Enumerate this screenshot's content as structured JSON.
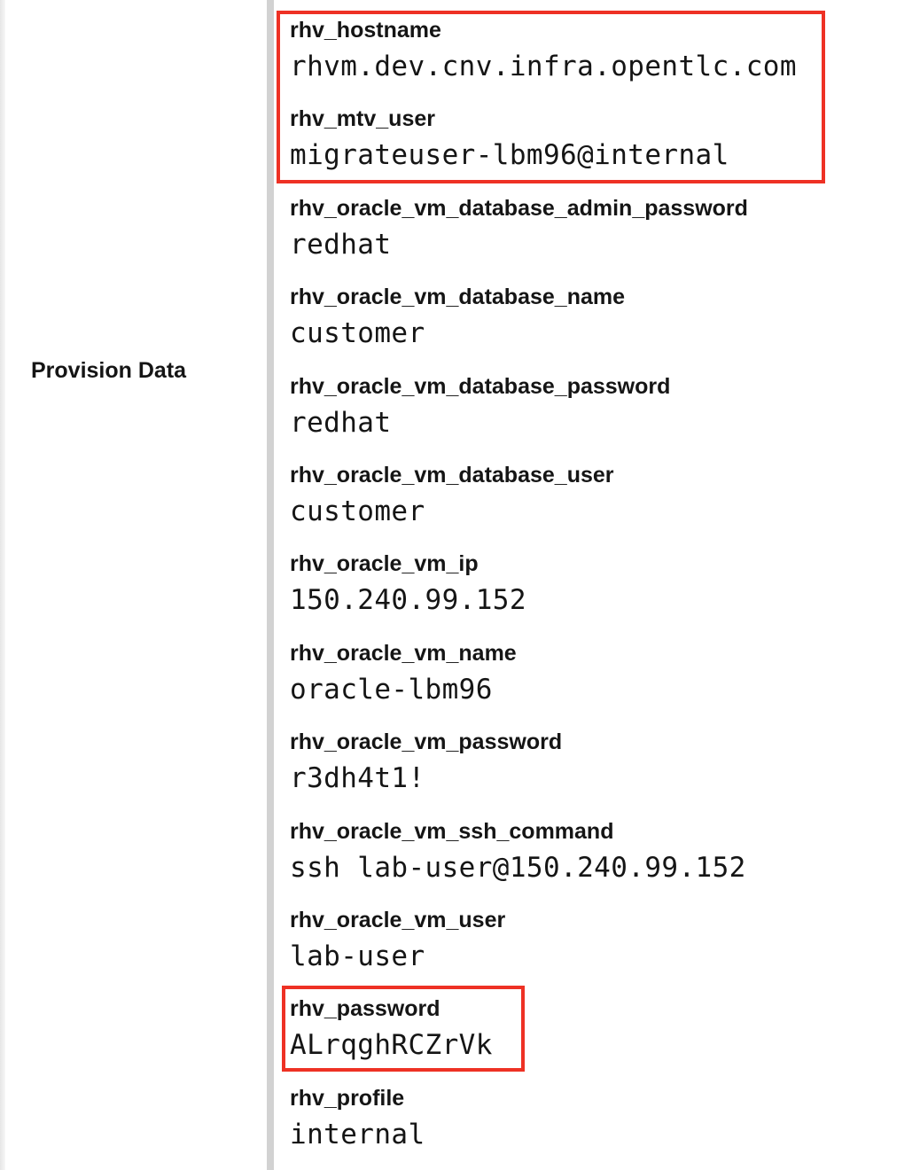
{
  "section": {
    "label": "Provision Data"
  },
  "fields": [
    {
      "key": "rhv_hostname",
      "value": "rhvm.dev.cnv.infra.opentlc.com"
    },
    {
      "key": "rhv_mtv_user",
      "value": "migrateuser-lbm96@internal"
    },
    {
      "key": "rhv_oracle_vm_database_admin_password",
      "value": "redhat"
    },
    {
      "key": "rhv_oracle_vm_database_name",
      "value": "customer"
    },
    {
      "key": "rhv_oracle_vm_database_password",
      "value": "redhat"
    },
    {
      "key": "rhv_oracle_vm_database_user",
      "value": "customer"
    },
    {
      "key": "rhv_oracle_vm_ip",
      "value": "150.240.99.152"
    },
    {
      "key": "rhv_oracle_vm_name",
      "value": "oracle-lbm96"
    },
    {
      "key": "rhv_oracle_vm_password",
      "value": "r3dh4t1!"
    },
    {
      "key": "rhv_oracle_vm_ssh_command",
      "value": "ssh lab-user@150.240.99.152"
    },
    {
      "key": "rhv_oracle_vm_user",
      "value": "lab-user"
    },
    {
      "key": "rhv_password",
      "value": "ALrqghRCZrVk"
    },
    {
      "key": "rhv_profile",
      "value": "internal"
    }
  ],
  "highlights": {
    "color": "#ee3124"
  }
}
